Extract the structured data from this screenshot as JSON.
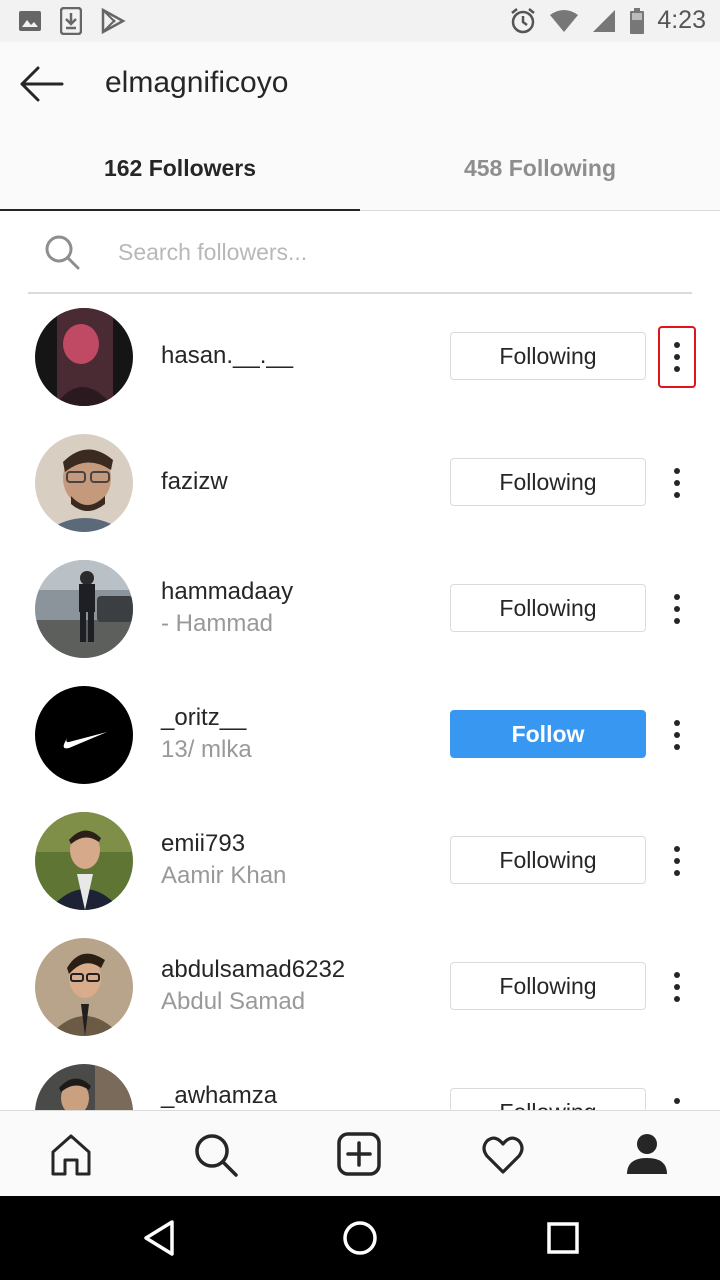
{
  "status_bar": {
    "time": "4:23"
  },
  "header": {
    "username": "elmagnificoyo"
  },
  "tabs": [
    {
      "label": "162 Followers",
      "active": true
    },
    {
      "label": "458 Following",
      "active": false
    }
  ],
  "search": {
    "placeholder": "Search followers..."
  },
  "followers": [
    {
      "username": "hasan.__.__",
      "full_name": "",
      "button": "Following",
      "avatar_bg": "#1a1a1a"
    },
    {
      "username": "fazizw",
      "full_name": "",
      "button": "Following",
      "avatar_bg": "#c9b9a6"
    },
    {
      "username": "hammadaay",
      "full_name": "- Hammad",
      "button": "Following",
      "avatar_bg": "#6f7a80"
    },
    {
      "username": "_oritz__",
      "full_name": "13/ mlka",
      "button": "Follow",
      "avatar_bg": "#000000"
    },
    {
      "username": "emii793",
      "full_name": "Aamir Khan",
      "button": "Following",
      "avatar_bg": "#6b7d3c"
    },
    {
      "username": "abdulsamad6232",
      "full_name": "Abdul Samad",
      "button": "Following",
      "avatar_bg": "#a08c72"
    },
    {
      "username": "_awhamza",
      "full_name": "",
      "button": "Following",
      "avatar_bg": "#3a3a3a"
    }
  ],
  "colors": {
    "accent": "#3897f0",
    "highlight": "#e0141a"
  },
  "bottom_nav": [
    "home-icon",
    "search-icon",
    "add-icon",
    "heart-icon",
    "profile-icon"
  ]
}
